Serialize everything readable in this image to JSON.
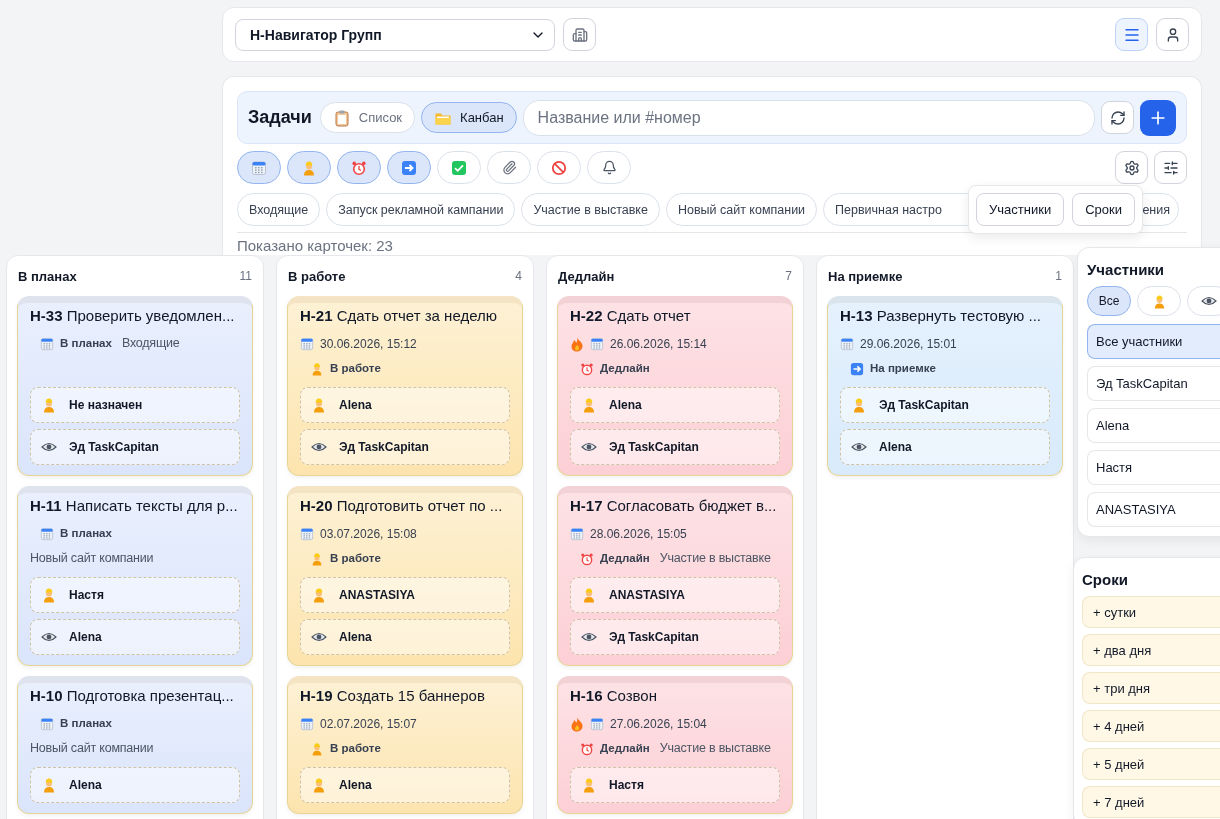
{
  "org_select": {
    "value": "Н-Навигатор Групп"
  },
  "header_buttons": [
    {
      "kind": "menu",
      "selected": true
    },
    {
      "kind": "user",
      "selected": false
    }
  ],
  "toolbar": {
    "title": "Задачи",
    "views": [
      {
        "kind": "list",
        "label": "Список",
        "selected": false
      },
      {
        "kind": "kanban",
        "label": "Канбан",
        "selected": true
      }
    ],
    "search": {
      "placeholder": "Название или #номер"
    }
  },
  "filters": [
    {
      "kind": "plan",
      "selected": true
    },
    {
      "kind": "work",
      "selected": true
    },
    {
      "kind": "deadline",
      "selected": true
    },
    {
      "kind": "review",
      "selected": true
    },
    {
      "kind": "done",
      "selected": false
    },
    {
      "kind": "clip",
      "selected": false
    },
    {
      "kind": "blocked",
      "selected": false
    },
    {
      "kind": "bell",
      "selected": false
    }
  ],
  "projects": [
    "Входящие",
    "Запуск рекламной кампании",
    "Участие в выставке",
    "Новый сайт компании",
    "Первичная настро",
    "ения"
  ],
  "settings_popup": {
    "items": [
      "Участники",
      "Сроки"
    ]
  },
  "shown_count": "Показано карточек: 23",
  "columns": [
    {
      "kind": "plan",
      "title": "В планах",
      "count": "11",
      "cards": [
        {
          "id": "Н-33",
          "title": "Проверить уведомлен...",
          "hot": false,
          "status": "В планах",
          "project": "Входящие",
          "assignee": "Не назначен",
          "watcher": "Эд TaskCapitan"
        },
        {
          "id": "Н-11",
          "title": "Написать тексты для р...",
          "hot": false,
          "status": "В планах",
          "project": "Новый сайт компании",
          "assignee": "Настя",
          "watcher": "Alena"
        },
        {
          "id": "Н-10",
          "title": "Подготовка презентац...",
          "hot": false,
          "status": "В планах",
          "project": "Новый сайт компании",
          "assignee": "Alena"
        }
      ]
    },
    {
      "kind": "work",
      "title": "В работе",
      "count": "4",
      "cards": [
        {
          "id": "Н-21",
          "title": "Сдать отчет за неделю",
          "hot": false,
          "date": "30.06.2026, 15:12",
          "status": "В работе",
          "assignee": "Alena",
          "watcher": "Эд TaskCapitan"
        },
        {
          "id": "Н-20",
          "title": "Подготовить отчет по ...",
          "hot": false,
          "date": "03.07.2026, 15:08",
          "status": "В работе",
          "assignee": "ANASTASIYA",
          "watcher": "Alena"
        },
        {
          "id": "Н-19",
          "title": "Создать 15 баннеров",
          "hot": false,
          "date": "02.07.2026, 15:07",
          "status": "В работе",
          "assignee": "Alena"
        }
      ]
    },
    {
      "kind": "deadline",
      "title": "Дедлайн",
      "count": "7",
      "cards": [
        {
          "id": "Н-22",
          "title": "Сдать отчет",
          "hot": true,
          "date": "26.06.2026, 15:14",
          "status": "Дедлайн",
          "assignee": "Alena",
          "watcher": "Эд TaskCapitan"
        },
        {
          "id": "Н-17",
          "title": "Согласовать бюджет в...",
          "hot": false,
          "date": "28.06.2026, 15:05",
          "status": "Дедлайн",
          "project": "Участие в выставке",
          "assignee": "ANASTASIYA",
          "watcher": "Эд TaskCapitan"
        },
        {
          "id": "Н-16",
          "title": "Созвон",
          "hot": true,
          "date": "27.06.2026, 15:04",
          "status": "Дедлайн",
          "project": "Участие в выставке",
          "assignee": "Настя"
        }
      ]
    },
    {
      "kind": "review",
      "title": "На приемке",
      "count": "1",
      "cards": [
        {
          "id": "Н-13",
          "title": "Развернуть тестовую ...",
          "hot": false,
          "date": "29.06.2026, 15:01",
          "status": "На приемке",
          "assignee": "Эд TaskCapitan",
          "watcher": "Alena"
        }
      ]
    }
  ],
  "participants": {
    "title": "Участники",
    "tabs": [
      {
        "kind": "all",
        "label": "Все",
        "selected": true
      },
      {
        "kind": "assignee",
        "selected": false
      },
      {
        "kind": "watcher",
        "selected": false
      }
    ],
    "items": [
      {
        "label": "Все участники",
        "selected": true
      },
      {
        "label": "Эд TaskCapitan",
        "selected": false
      },
      {
        "label": "Alena",
        "selected": false
      },
      {
        "label": "Настя",
        "selected": false
      },
      {
        "label": "ANASTASIYA",
        "selected": false
      }
    ]
  },
  "deadlines": {
    "title": "Сроки",
    "items": [
      "+ сутки",
      "+ два дня",
      "+ три дня",
      "+ 4 дней",
      "+ 5 дней",
      "+ 7 дней"
    ]
  }
}
